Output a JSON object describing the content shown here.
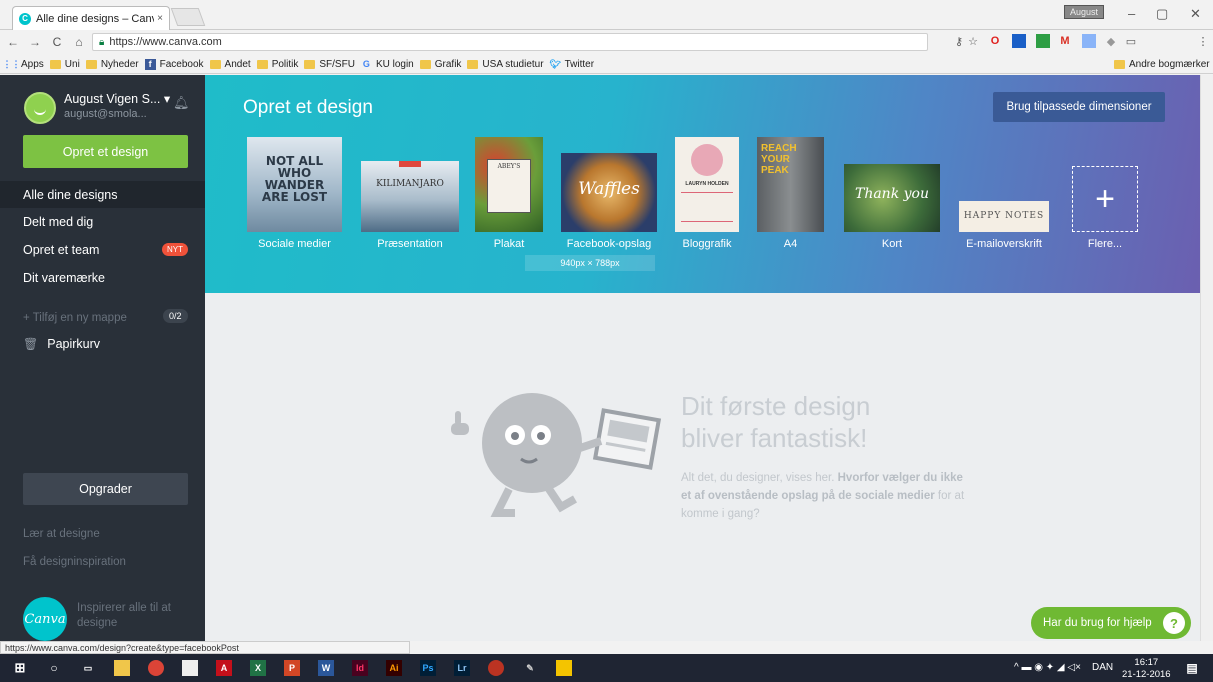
{
  "browser": {
    "tab_title": "Alle dine designs – Canv",
    "tab_close": "×",
    "user_chip": "August",
    "url": "https://www.canva.com",
    "status_url": "https://www.canva.com/design?create&type=facebookPost"
  },
  "bookmarks": {
    "apps": "Apps",
    "items": [
      "Uni",
      "Nyheder",
      "Facebook",
      "Andet",
      "Politik",
      "SF/SFU",
      "KU login",
      "Grafik",
      "USA studietur",
      "Twitter"
    ],
    "other": "Andre bogmærker"
  },
  "sidebar": {
    "user_name": "August Vigen S... ▾",
    "user_email": "august@smola...",
    "create_button": "Opret et design",
    "nav": [
      {
        "label": "Alle dine designs"
      },
      {
        "label": "Delt med dig"
      },
      {
        "label": "Opret et team",
        "badge": "NYT"
      },
      {
        "label": "Dit varemærke"
      }
    ],
    "add_folder": "+ Tilføj en ny mappe",
    "folder_count": "0/2",
    "trash": "Papirkurv",
    "upgrade": "Opgrader",
    "learn": "Lær at designe",
    "inspiration": "Få designinspiration",
    "logo_text": "Canva",
    "inspire_text": "Inspirerer alle til at designe"
  },
  "banner": {
    "title": "Opret et design",
    "custom_button": "Brug tilpassede dimensioner",
    "tooltip": "940px × 788px",
    "more": "Flere...",
    "templates": [
      {
        "label": "Sociale medier",
        "thumb_text": "NOT ALL WHO WANDER ARE LOST"
      },
      {
        "label": "Præsentation",
        "thumb_text": "KILIMANJARO"
      },
      {
        "label": "Plakat",
        "thumb_text": "ABEY'S"
      },
      {
        "label": "Facebook-opslag",
        "thumb_text": "Waffles"
      },
      {
        "label": "Bloggrafik",
        "thumb_text": "LAURYN HOLDEN"
      },
      {
        "label": "A4",
        "thumb_text": "REACH YOUR PEAK"
      },
      {
        "label": "Kort",
        "thumb_text": "Thank you"
      },
      {
        "label": "E-mailoverskrift",
        "thumb_text": "HAPPY NOTES"
      }
    ]
  },
  "empty_state": {
    "line1": "Dit første design",
    "line2": "bliver fantastisk!",
    "body_prefix": "Alt det, du designer, vises her. ",
    "body_bold": "Hvorfor vælger du ikke et af ovenstående opslag på de sociale medier",
    "body_suffix": " for at komme i gang?"
  },
  "help_button": "Har du brug for hjælp",
  "taskbar": {
    "tray_lang": "DAN",
    "time": "16:17",
    "date": "21-12-2016"
  }
}
